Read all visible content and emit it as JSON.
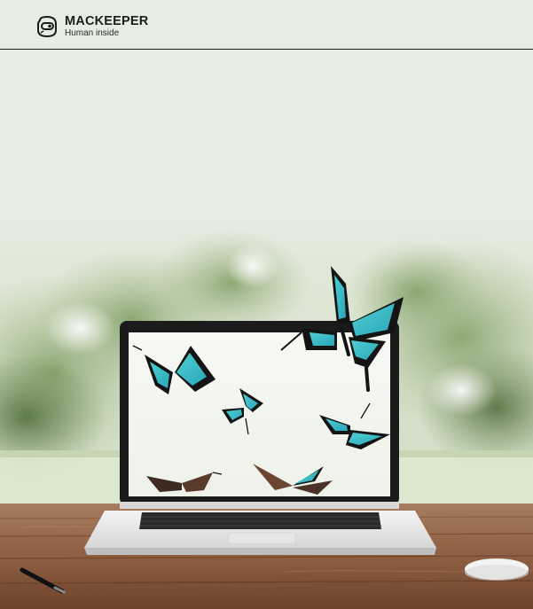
{
  "header": {
    "brand_name": "MACKEEPER",
    "tagline": "Human inside",
    "logo_icon": "mackeeper-logo-icon"
  },
  "hero": {
    "image_subject": "laptop-with-butterflies",
    "colors": {
      "background": "#e7ede2",
      "butterfly_wing": "#3fc1c8",
      "butterfly_body": "#141414",
      "wood": "#8a5a3c"
    }
  }
}
